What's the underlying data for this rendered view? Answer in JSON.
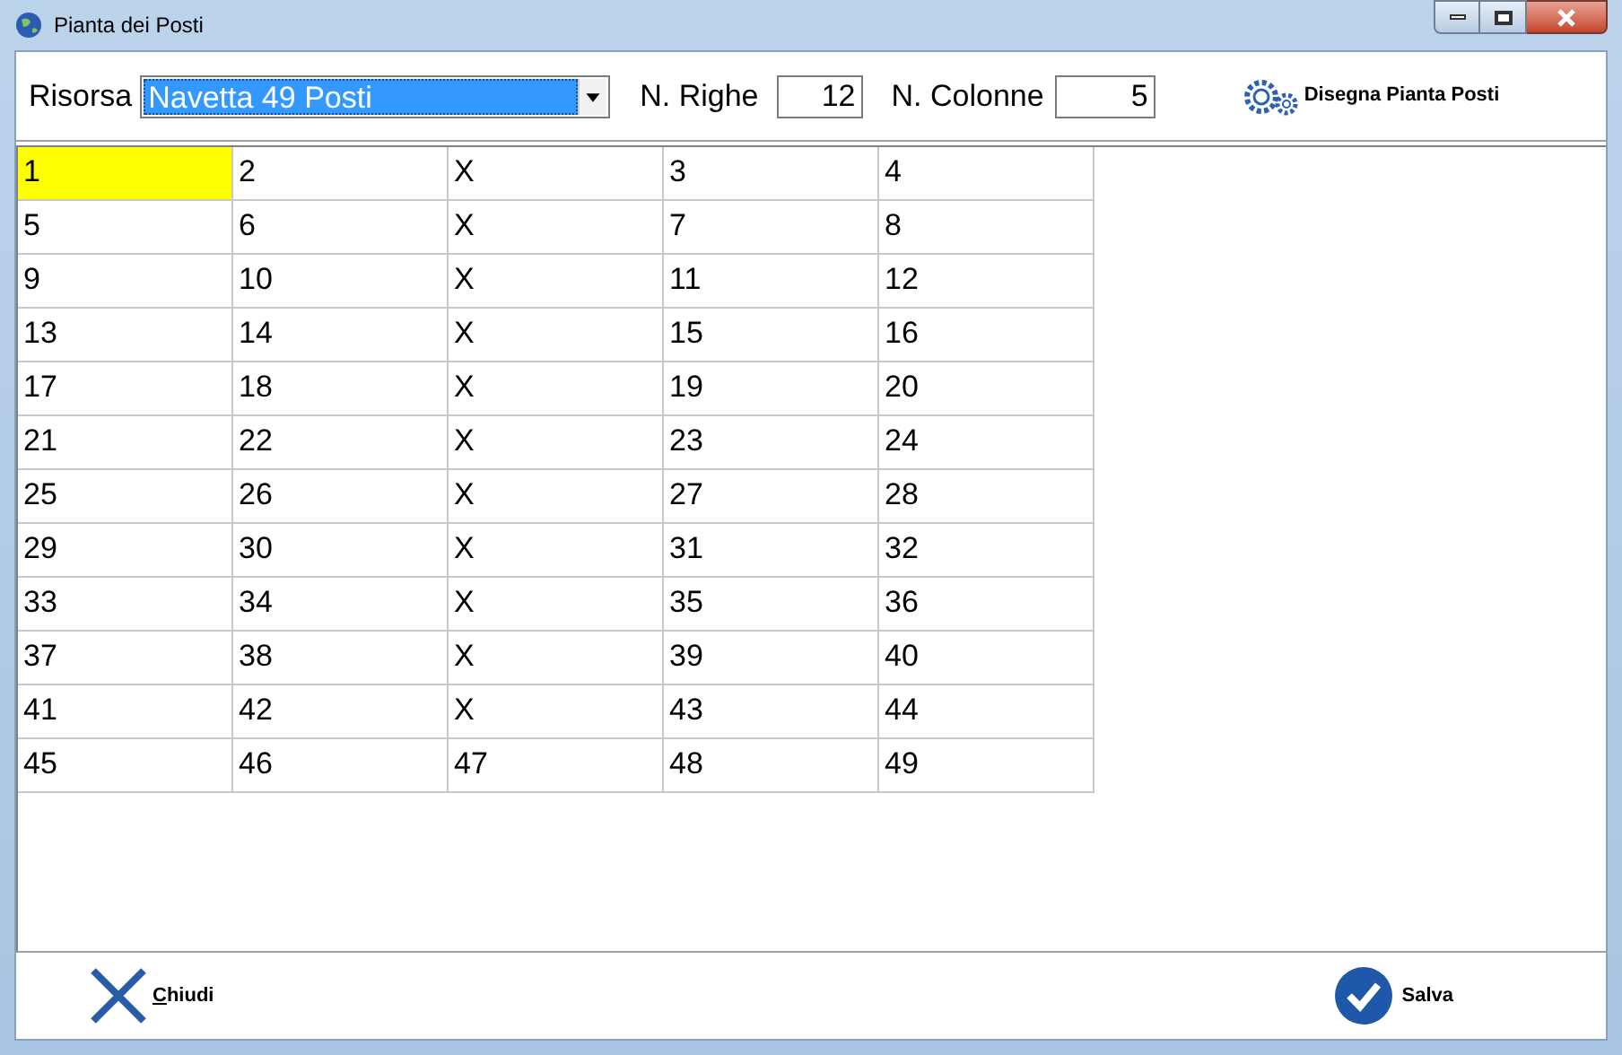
{
  "window": {
    "title": "Pianta dei Posti"
  },
  "toolbar": {
    "resource_label": "Risorsa",
    "resource_value": "Navetta 49 Posti",
    "rows_label": "N. Righe",
    "rows_value": "12",
    "columns_label": "N. Colonne",
    "columns_value": "5",
    "draw_button": "Disegna Pianta Posti"
  },
  "grid": {
    "rows": [
      [
        {
          "text": "1",
          "selected": true
        },
        {
          "text": "2",
          "selected": false
        },
        {
          "text": "X",
          "selected": false
        },
        {
          "text": "3",
          "selected": false
        },
        {
          "text": "4",
          "selected": false
        }
      ],
      [
        {
          "text": "5",
          "selected": false
        },
        {
          "text": "6",
          "selected": false
        },
        {
          "text": "X",
          "selected": false
        },
        {
          "text": "7",
          "selected": false
        },
        {
          "text": "8",
          "selected": false
        }
      ],
      [
        {
          "text": "9",
          "selected": false
        },
        {
          "text": "10",
          "selected": false
        },
        {
          "text": "X",
          "selected": false
        },
        {
          "text": "11",
          "selected": false
        },
        {
          "text": "12",
          "selected": false
        }
      ],
      [
        {
          "text": "13",
          "selected": false
        },
        {
          "text": "14",
          "selected": false
        },
        {
          "text": "X",
          "selected": false
        },
        {
          "text": "15",
          "selected": false
        },
        {
          "text": "16",
          "selected": false
        }
      ],
      [
        {
          "text": "17",
          "selected": false
        },
        {
          "text": "18",
          "selected": false
        },
        {
          "text": "X",
          "selected": false
        },
        {
          "text": "19",
          "selected": false
        },
        {
          "text": "20",
          "selected": false
        }
      ],
      [
        {
          "text": "21",
          "selected": false
        },
        {
          "text": "22",
          "selected": false
        },
        {
          "text": "X",
          "selected": false
        },
        {
          "text": "23",
          "selected": false
        },
        {
          "text": "24",
          "selected": false
        }
      ],
      [
        {
          "text": "25",
          "selected": false
        },
        {
          "text": "26",
          "selected": false
        },
        {
          "text": "X",
          "selected": false
        },
        {
          "text": "27",
          "selected": false
        },
        {
          "text": "28",
          "selected": false
        }
      ],
      [
        {
          "text": "29",
          "selected": false
        },
        {
          "text": "30",
          "selected": false
        },
        {
          "text": "X",
          "selected": false
        },
        {
          "text": "31",
          "selected": false
        },
        {
          "text": "32",
          "selected": false
        }
      ],
      [
        {
          "text": "33",
          "selected": false
        },
        {
          "text": "34",
          "selected": false
        },
        {
          "text": "X",
          "selected": false
        },
        {
          "text": "35",
          "selected": false
        },
        {
          "text": "36",
          "selected": false
        }
      ],
      [
        {
          "text": "37",
          "selected": false
        },
        {
          "text": "38",
          "selected": false
        },
        {
          "text": "X",
          "selected": false
        },
        {
          "text": "39",
          "selected": false
        },
        {
          "text": "40",
          "selected": false
        }
      ],
      [
        {
          "text": "41",
          "selected": false
        },
        {
          "text": "42",
          "selected": false
        },
        {
          "text": "X",
          "selected": false
        },
        {
          "text": "43",
          "selected": false
        },
        {
          "text": "44",
          "selected": false
        }
      ],
      [
        {
          "text": "45",
          "selected": false
        },
        {
          "text": "46",
          "selected": false
        },
        {
          "text": "47",
          "selected": false
        },
        {
          "text": "48",
          "selected": false
        },
        {
          "text": "49",
          "selected": false
        }
      ]
    ]
  },
  "footer": {
    "close_button": "Chiudi",
    "save_button": "Salva"
  }
}
